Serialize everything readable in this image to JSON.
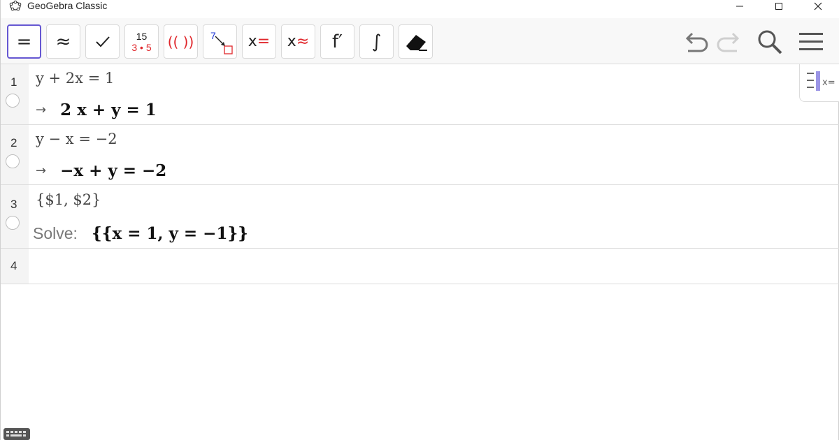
{
  "window": {
    "title": "GeoGebra Classic",
    "icon": "geogebra-logo-icon",
    "controls": [
      "minimize-icon",
      "maximize-icon",
      "close-icon"
    ]
  },
  "toolbar": {
    "tools": [
      {
        "name": "evaluate",
        "icon": "equals-icon",
        "label": "=",
        "selected": true
      },
      {
        "name": "numeric",
        "icon": "approx-icon",
        "label": "≈"
      },
      {
        "name": "keep-input",
        "icon": "checkmark-icon",
        "label": "✓"
      },
      {
        "name": "factor",
        "icon": "factor-icon",
        "top": "15",
        "bottom": "3 • 5"
      },
      {
        "name": "expand",
        "icon": "expand-icon",
        "label": "(( ))"
      },
      {
        "name": "substitute",
        "icon": "substitute-icon",
        "label": "7"
      },
      {
        "name": "solve",
        "icon": "solve-icon",
        "x": "x",
        "sign": "="
      },
      {
        "name": "solve-numerically",
        "icon": "nsolve-icon",
        "x": "x",
        "sign": "≈"
      },
      {
        "name": "derivative",
        "icon": "derivative-icon",
        "label": "f′"
      },
      {
        "name": "integral",
        "icon": "integral-icon",
        "label": "∫"
      },
      {
        "name": "delete",
        "icon": "eraser-icon"
      }
    ],
    "right": [
      "undo-icon",
      "redo-icon",
      "search-icon",
      "menu-icon"
    ]
  },
  "algebra": {
    "rows": [
      {
        "number": "1",
        "input": "y + 2x  =  1",
        "output": "2 x + y = 1",
        "prefix": "→"
      },
      {
        "number": "2",
        "input": "y − x  =  −2",
        "output": "−x + y = −2",
        "prefix": "→"
      },
      {
        "number": "3",
        "input": "{$1, $2}",
        "output": "{{x = 1, y = −1}}",
        "prefix": "Solve:"
      },
      {
        "number": "4",
        "input": "",
        "output": "",
        "prefix": ""
      }
    ]
  },
  "colors": {
    "accent": "#6557d2",
    "red": "#e0262b",
    "blue": "#1a33d6",
    "toolbar_bg": "#f8f8f8",
    "margin_bg": "#f4f4f4"
  }
}
